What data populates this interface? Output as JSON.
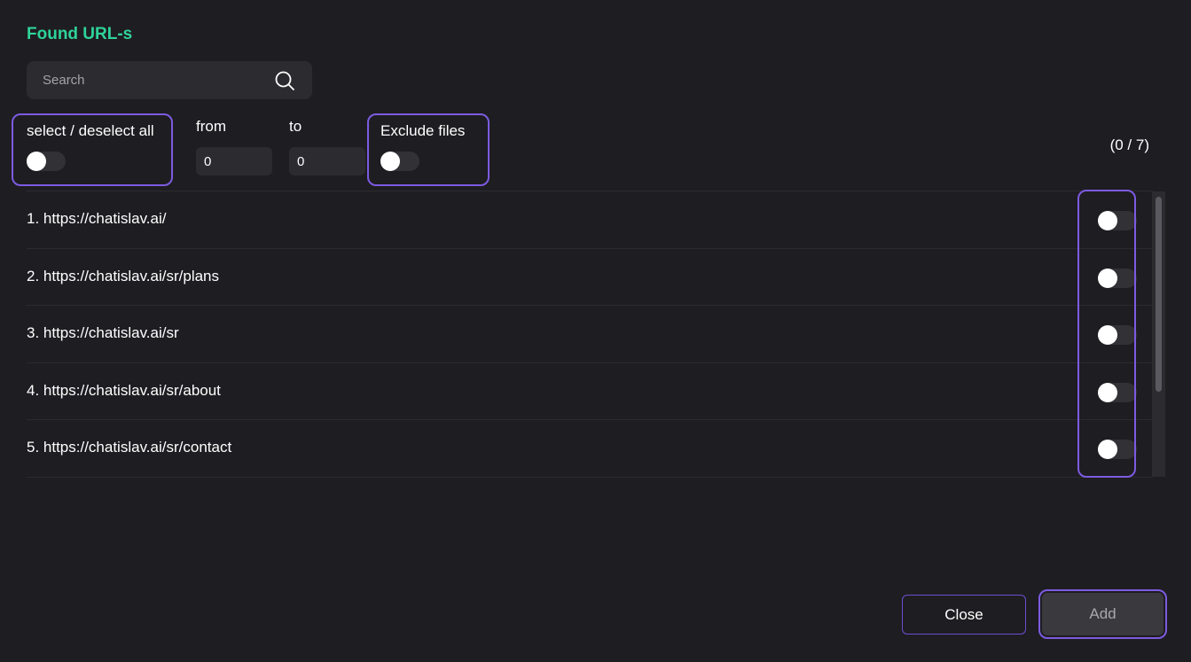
{
  "dialog": {
    "title": "Found URL-s",
    "search": {
      "placeholder": "Search",
      "value": "",
      "icon": "search-icon"
    },
    "filters": {
      "select_all_label": "select / deselect all",
      "select_all_on": false,
      "from_label": "from",
      "from_value": "0",
      "to_label": "to",
      "to_value": "0",
      "exclude_files_label": "Exclude files",
      "exclude_files_on": false
    },
    "counter": "(0 / 7)",
    "urls": [
      {
        "label": "1. https://chatislav.ai/",
        "selected": false
      },
      {
        "label": "2. https://chatislav.ai/sr/plans",
        "selected": false
      },
      {
        "label": "3. https://chatislav.ai/sr",
        "selected": false
      },
      {
        "label": "4. https://chatislav.ai/sr/about",
        "selected": false
      },
      {
        "label": "5. https://chatislav.ai/sr/contact",
        "selected": false
      }
    ],
    "buttons": {
      "close_label": "Close",
      "add_label": "Add"
    },
    "colors": {
      "accent_title": "#2fd39a",
      "highlight": "#7c5be0",
      "background": "#1e1d21"
    }
  }
}
